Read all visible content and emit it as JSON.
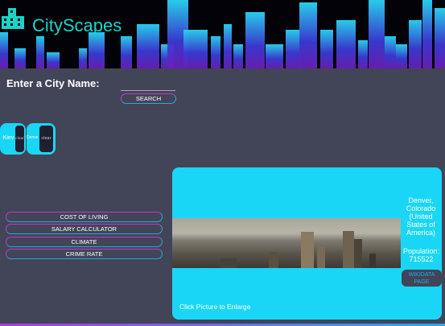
{
  "header": {
    "title": "CityScapes",
    "logo_icon": "building-icon"
  },
  "search": {
    "prompt": "Enter a City Name:",
    "value": "",
    "button_label": "SEARCH"
  },
  "saved_cities": [
    {
      "name": "Kiev",
      "clear_label": "clear"
    },
    {
      "name": "Denver",
      "clear_label": "clear"
    }
  ],
  "menu": [
    "COST OF LIVING",
    "SALARY CALCULATOR",
    "CLIMATE",
    "CRIME RATE"
  ],
  "city_card": {
    "location": "Denver, Colorado (United States of America)",
    "population": "Population: 715522",
    "wiki_button": "WIKIDATA PAGE",
    "enlarge_hint": "Click Picture to Enlarge"
  },
  "colors": {
    "background": "#424458",
    "accent": "#1ad6f6",
    "title": "#19d4c8"
  }
}
